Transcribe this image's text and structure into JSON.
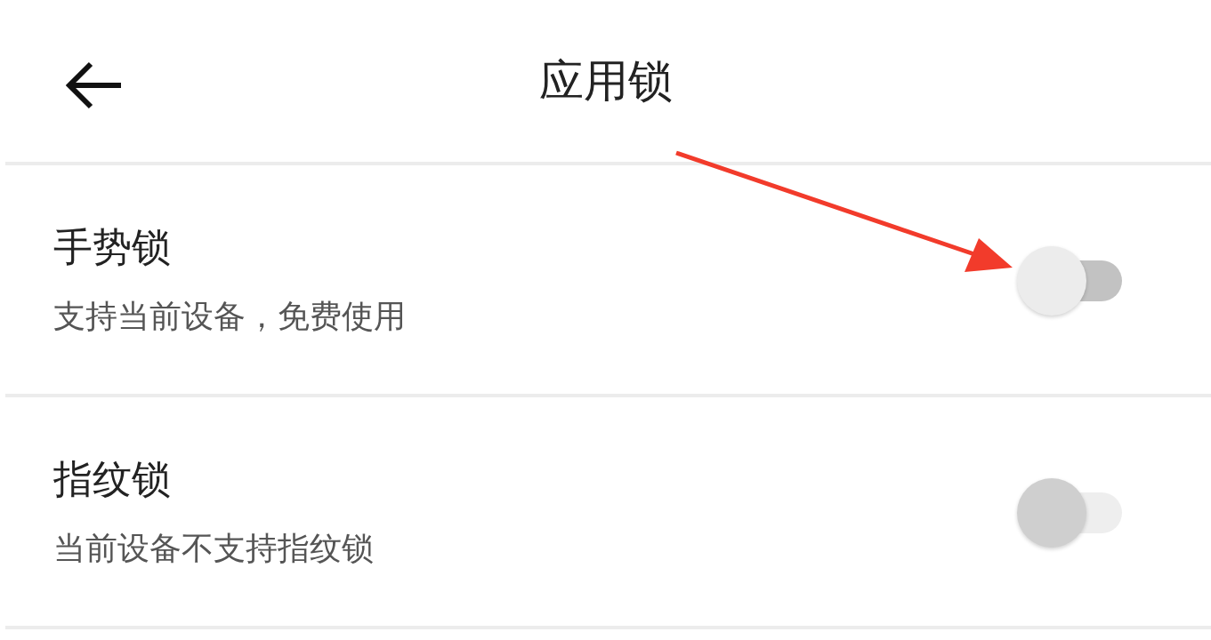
{
  "header": {
    "title": "应用锁"
  },
  "settings": [
    {
      "title": "手势锁",
      "subtitle": "支持当前设备，免费使用",
      "on": false,
      "disabled": false
    },
    {
      "title": "指纹锁",
      "subtitle": "当前设备不支持指纹锁",
      "on": false,
      "disabled": true
    }
  ]
}
